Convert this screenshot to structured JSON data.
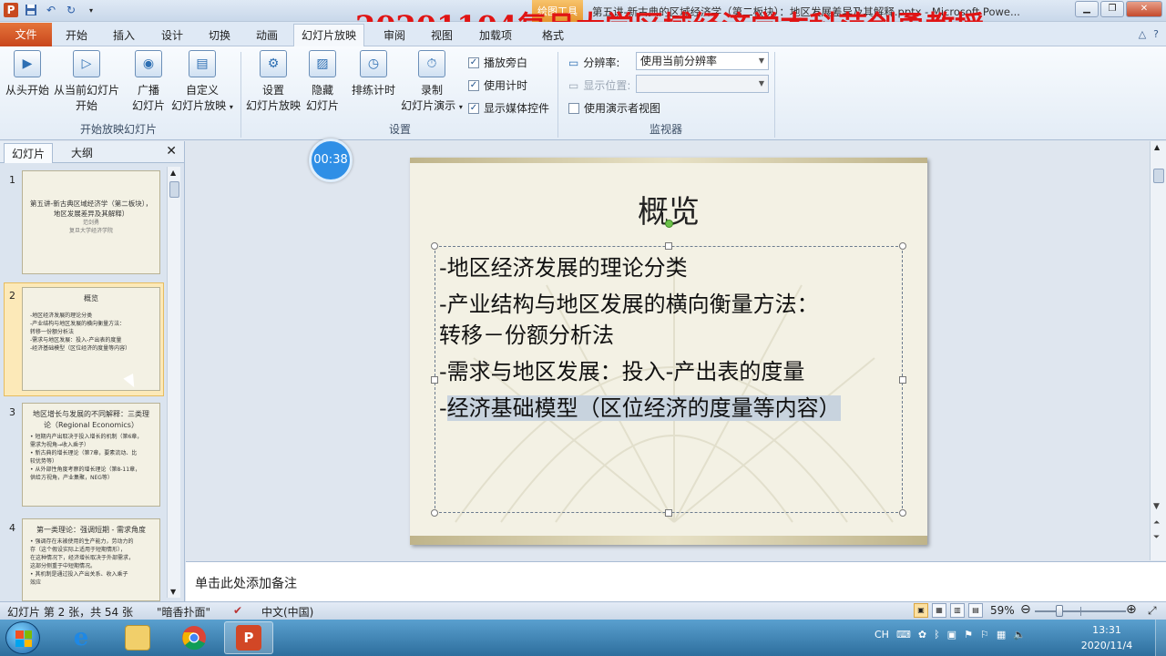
{
  "window": {
    "title": "第五讲-新古典的区域经济学（第二板块）：地区发展差异及其解释.pptx - Microsoft Powe...",
    "context_tool": "绘图工具",
    "watermark": "20201104复旦大学区域经济学本科范剑勇教授"
  },
  "tabs": [
    {
      "label": "文件"
    },
    {
      "label": "开始"
    },
    {
      "label": "插入"
    },
    {
      "label": "设计"
    },
    {
      "label": "切换"
    },
    {
      "label": "动画"
    },
    {
      "label": "幻灯片放映"
    },
    {
      "label": "审阅"
    },
    {
      "label": "视图"
    },
    {
      "label": "加载项"
    },
    {
      "label": "格式"
    }
  ],
  "ribbon": {
    "start_group": {
      "label": "开始放映幻灯片",
      "from_beginning": "从头开始",
      "from_current_1": "从当前幻灯片",
      "from_current_2": "开始",
      "broadcast_1": "广播",
      "broadcast_2": "幻灯片",
      "custom_1": "自定义",
      "custom_2": "幻灯片放映"
    },
    "setup_group": {
      "label": "设置",
      "setup_1": "设置",
      "setup_2": "幻灯片放映",
      "hide_1": "隐藏",
      "hide_2": "幻灯片",
      "rehearse": "排练计时",
      "record_1": "录制",
      "record_2": "幻灯片演示",
      "play_narrations": "播放旁白",
      "use_timings": "使用计时",
      "show_media": "显示媒体控件"
    },
    "monitor_group": {
      "label": "监视器",
      "resolution_label": "分辨率:",
      "resolution_value": "使用当前分辨率",
      "show_on_label": "显示位置:",
      "presenter_view": "使用演示者视图"
    }
  },
  "left_pane": {
    "tab_slides": "幻灯片",
    "tab_outline": "大纲",
    "thumbs": [
      {
        "num": "1",
        "title": "第五讲-新古典区域经济学（第二板块），地区发展差异及其解释）",
        "sub1": "范剑勇",
        "sub2": "复旦大学经济学院"
      },
      {
        "num": "2",
        "head": "概览",
        "lines": [
          "-地区经济发展的理论分类",
          "-产业结构与地区发展的横向衡量方法：",
          "转移一份额分析法",
          "-需求与地区发展：投入-产出表的度量",
          "-经济基础模型（区位经济的度量等内容）"
        ]
      },
      {
        "num": "3",
        "head": "地区增长与发展的不同解释：三类理论（Regional Economics）",
        "lines": [
          "• 短期内产出取决于投入增长的机制（第6章，",
          "  需求为视角→收入乘子）",
          "• 新古典的增长理论（第7章，要素流动、比",
          "  较优势等）",
          "• 从外部性角度考察的增长理论（第8-11章，",
          "  供给方视角，产业集聚，NEG等）"
        ]
      },
      {
        "num": "4",
        "head": "第一类理论：强调短期 - 需求角度",
        "lines": [
          "• 强调存在未被使用的生产能力，劳动力的",
          "  存（这个假设实际上适用于短期情形），",
          "  在这种情况下，经济增长取决于外部需求，",
          "  这部分侧重于中短期情况。",
          "• 其机制是通过投入产出关系、收入乘子",
          "  效应"
        ]
      }
    ]
  },
  "slide": {
    "title": "概览",
    "bullets": [
      "-地区经济发展的理论分类",
      "-产业结构与地区发展的横向衡量方法：",
      "转移－份额分析法",
      "-需求与地区发展：投入-产出表的度量",
      "-",
      "经济基础模型（区位经济的度量等内容）"
    ]
  },
  "timer": "00:38",
  "notes_placeholder": "单击此处添加备注",
  "status": {
    "slide_info": "幻灯片 第 2 张，共 54 张",
    "theme": "\"暗香扑面\"",
    "language": "中文(中国)",
    "zoom": "59%",
    "zoom_level": 0.59
  },
  "taskbar": {
    "ime": "CH",
    "time": "13:31",
    "date": "2020/11/4"
  },
  "colors": {
    "accent_file_tab": "#c8461c",
    "watermark": "#e01414",
    "timer": "#2f8fe6"
  }
}
